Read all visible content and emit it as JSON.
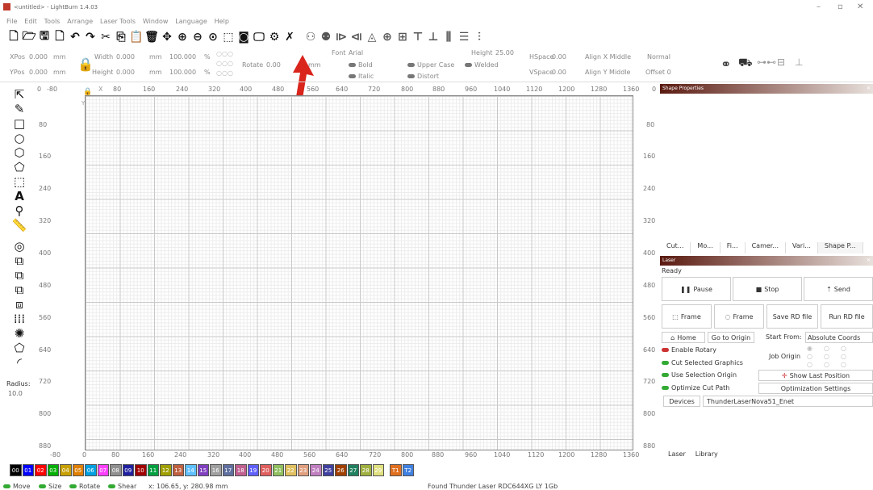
{
  "titlebar": {
    "title": "<untitled> - LightBurn 1.4.03",
    "minimize": "–",
    "maximize": "▫",
    "close": "✕"
  },
  "menu": [
    "File",
    "Edit",
    "Tools",
    "Arrange",
    "Laser Tools",
    "Window",
    "Language",
    "Help"
  ],
  "toolbar2": {
    "xpos_label": "XPos",
    "xpos": "0.000",
    "ypos_label": "YPos",
    "ypos": "0.000",
    "unit": "mm",
    "width_label": "Width",
    "width": "0.000",
    "height_label": "Height",
    "height": "0.000",
    "pct": "100.000",
    "pct_sym": "%",
    "rotate_label": "Rotate",
    "rotate": "0.00",
    "rotate_unit": "mm",
    "font_label": "Font",
    "font": "Arial",
    "font_height_label": "Height",
    "font_height": "25.00",
    "hspace_label": "HSpace",
    "hspace": "0.00",
    "vspace_label": "VSpace",
    "vspace": "0.00",
    "align_x": "Align X Middle",
    "align_y": "Align Y Middle",
    "normal": "Normal",
    "offset": "Offset 0",
    "bold": "Bold",
    "italic": "Italic",
    "upper_case": "Upper Case",
    "distort": "Distort",
    "welded": "Welded"
  },
  "ruler_top": [
    "0",
    "-80",
    "X",
    "80",
    "160",
    "240",
    "320",
    "400",
    "480",
    "560",
    "640",
    "720",
    "800",
    "880",
    "960",
    "1040",
    "1120",
    "1200",
    "1280",
    "1360",
    "0"
  ],
  "ruler_left": [
    "80",
    "160",
    "240",
    "320",
    "400",
    "480",
    "560",
    "640",
    "720",
    "800",
    "880",
    "-80"
  ],
  "ruler_right": [
    "80",
    "160",
    "240",
    "320",
    "400",
    "480",
    "560",
    "640",
    "720",
    "800",
    "880"
  ],
  "ruler_bottom": [
    "0",
    "80",
    "160",
    "240",
    "320",
    "400",
    "480",
    "560",
    "640",
    "720",
    "800",
    "880",
    "960",
    "1040",
    "1120",
    "1200",
    "1280",
    "1360"
  ],
  "axis_y_marker": "Y",
  "radius": {
    "label": "Radius:",
    "value": "10.0"
  },
  "shape_panel": {
    "title": "Shape Properties",
    "tabs": [
      "Cut...",
      "Mo...",
      "Fi...",
      "Camer...",
      "Vari...",
      "Shape P..."
    ]
  },
  "laser_panel": {
    "title": "Laser",
    "status": "Ready",
    "pause": "Pause",
    "stop": "Stop",
    "send": "Send",
    "frame1": "Frame",
    "frame2": "Frame",
    "save_rd": "Save RD file",
    "run_rd": "Run RD file",
    "home": "Home",
    "go_origin": "Go to Origin",
    "start_from_label": "Start From:",
    "start_from": "Absolute Coords",
    "enable_rotary": "Enable Rotary",
    "cut_selected": "Cut Selected Graphics",
    "use_selection": "Use Selection Origin",
    "optimize_cut": "Optimize Cut Path",
    "job_origin": "Job Origin",
    "show_last": "Show Last Position",
    "opt_settings": "Optimization Settings",
    "devices": "Devices",
    "device_name": "ThunderLaserNova51_Enet"
  },
  "bottom_tabs": [
    "Laser",
    "Library"
  ],
  "palette": [
    {
      "label": "00",
      "color": "#000000"
    },
    {
      "label": "01",
      "color": "#0000ff"
    },
    {
      "label": "02",
      "color": "#ff0000"
    },
    {
      "label": "03",
      "color": "#00b000"
    },
    {
      "label": "04",
      "color": "#c8a000"
    },
    {
      "label": "05",
      "color": "#e08000"
    },
    {
      "label": "06",
      "color": "#00a0e0"
    },
    {
      "label": "07",
      "color": "#ff40ff"
    },
    {
      "label": "08",
      "color": "#909090"
    },
    {
      "label": "09",
      "color": "#2020a0"
    },
    {
      "label": "10",
      "color": "#a00000"
    },
    {
      "label": "11",
      "color": "#00a040"
    },
    {
      "label": "12",
      "color": "#a0a000"
    },
    {
      "label": "13",
      "color": "#c06040"
    },
    {
      "label": "14",
      "color": "#60c0ff"
    },
    {
      "label": "15",
      "color": "#8040c0"
    },
    {
      "label": "16",
      "color": "#a0a0a0"
    },
    {
      "label": "17",
      "color": "#6070a0"
    },
    {
      "label": "18",
      "color": "#c06090"
    },
    {
      "label": "19",
      "color": "#6060ff"
    },
    {
      "label": "20",
      "color": "#e06060"
    },
    {
      "label": "21",
      "color": "#90c060"
    },
    {
      "label": "22",
      "color": "#e0c060"
    },
    {
      "label": "23",
      "color": "#e0a080"
    },
    {
      "label": "24",
      "color": "#c080c0"
    },
    {
      "label": "25",
      "color": "#4040a0"
    },
    {
      "label": "26",
      "color": "#a04000"
    },
    {
      "label": "27",
      "color": "#208060"
    },
    {
      "label": "28",
      "color": "#a0b040"
    },
    {
      "label": "29",
      "color": "#e0e080"
    },
    {
      "label": "T1",
      "color": "#e07020"
    },
    {
      "label": "T2",
      "color": "#4080e0"
    }
  ],
  "status": {
    "move": "Move",
    "size": "Size",
    "rotate": "Rotate",
    "shear": "Shear",
    "coords": "x: 106.65, y: 280.98 mm",
    "found": "Found Thunder Laser RDC644XG LY 1Gb"
  }
}
